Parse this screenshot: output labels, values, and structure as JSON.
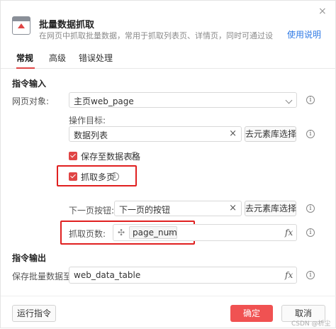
{
  "dialog": {
    "title": "批量数据抓取",
    "subtitle": "在网页中抓取批量数据，常用于抓取列表页、详情页，同时可通过设置分页...",
    "help_link": "使用说明",
    "close_glyph": "×"
  },
  "tabs": [
    {
      "label": "常规",
      "active": true
    },
    {
      "label": "高级",
      "active": false
    },
    {
      "label": "错误处理",
      "active": false
    }
  ],
  "input_section": {
    "title": "指令输入",
    "page_object": {
      "label": "网页对象:",
      "value": "主页web_page"
    },
    "target": {
      "label": "操作目标:",
      "value": "数据列表",
      "clear": "×",
      "choose_button": "去元素库选择"
    },
    "save_to_table": {
      "label": "保存至数据表格",
      "checked": true
    },
    "scrape_multi_page": {
      "label": "抓取多页",
      "checked": true
    },
    "next_page": {
      "label": "下一页按钮:",
      "value": "下一页的按钮",
      "clear": "×",
      "choose_button": "去元素库选择"
    },
    "page_count": {
      "label": "抓取页数:",
      "tag": "page_num",
      "tag_remove": "×",
      "fx": "fx"
    }
  },
  "output_section": {
    "title": "指令输出",
    "save_var": {
      "label": "保存批量数据至:",
      "value": "web_data_table",
      "fx": "fx"
    }
  },
  "footer": {
    "run_button": "运行指令",
    "confirm_button": "确定",
    "cancel_button": "取消"
  },
  "watermark": "CSDN @析尘",
  "colors": {
    "accent": "#f05252",
    "highlight": "#e02020",
    "link": "#2f7ae5"
  },
  "icons": {
    "info": "info-icon",
    "variable": "variable-icon",
    "app": "download-app-icon"
  }
}
